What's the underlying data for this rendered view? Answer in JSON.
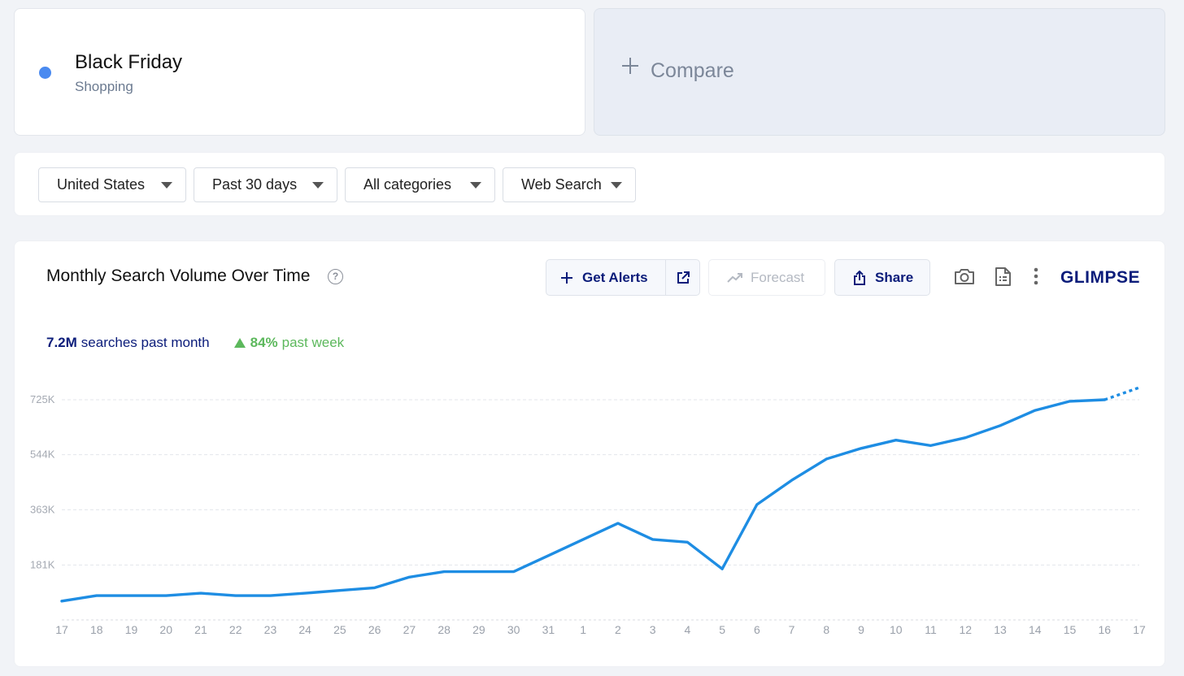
{
  "term": {
    "name": "Black Friday",
    "category": "Shopping",
    "dot_color": "#4a8af0",
    "dot_icon": "series-color-dot"
  },
  "compare": {
    "label": "Compare",
    "icon": "plus-icon"
  },
  "filters": {
    "country": "United States",
    "time_range": "Past 30 days",
    "category": "All categories",
    "source": "Web Search",
    "icon": "caret-down-icon"
  },
  "chart_panel": {
    "title": "Monthly Search Volume Over Time",
    "help_icon": "question-circle-icon",
    "buttons": {
      "alerts": "Get Alerts",
      "forecast": "Forecast",
      "share": "Share"
    },
    "icons": [
      "plus-icon",
      "external-link-icon",
      "trend-up-icon",
      "share-icon",
      "camera-icon",
      "document-icon",
      "more-vertical-icon"
    ],
    "brand": "GLIMPSE",
    "stats": {
      "volume": "7.2M",
      "volume_label": "searches past month",
      "change": "84%",
      "change_label": "past week",
      "change_color": "#5cb85c"
    }
  },
  "chart_data": {
    "type": "line",
    "title": "",
    "xlabel": "",
    "ylabel": "",
    "categories": [
      "17",
      "18",
      "19",
      "20",
      "21",
      "22",
      "23",
      "24",
      "25",
      "26",
      "27",
      "28",
      "29",
      "30",
      "31",
      "1",
      "2",
      "3",
      "4",
      "5",
      "6",
      "7",
      "8",
      "9",
      "10",
      "11",
      "12",
      "13",
      "14",
      "15",
      "16",
      "17"
    ],
    "series": [
      {
        "values": [
          62000,
          80000,
          80000,
          80000,
          88000,
          80000,
          80000,
          88000,
          97000,
          106000,
          141000,
          159000,
          159000,
          159000,
          212000,
          265000,
          318000,
          265000,
          256000,
          168000,
          380000,
          460000,
          530000,
          565000,
          592000,
          574000,
          600000,
          640000,
          690000,
          720000,
          725000,
          765000
        ],
        "color": "#1e8de3",
        "forecast_from_index": 30
      }
    ],
    "yticks": [
      181000,
      363000,
      544000,
      725000
    ],
    "ytick_labels": [
      "181K",
      "363K",
      "544K",
      "725K"
    ],
    "ylim": [
      0,
      725000
    ],
    "grid": true,
    "legend": "none"
  }
}
